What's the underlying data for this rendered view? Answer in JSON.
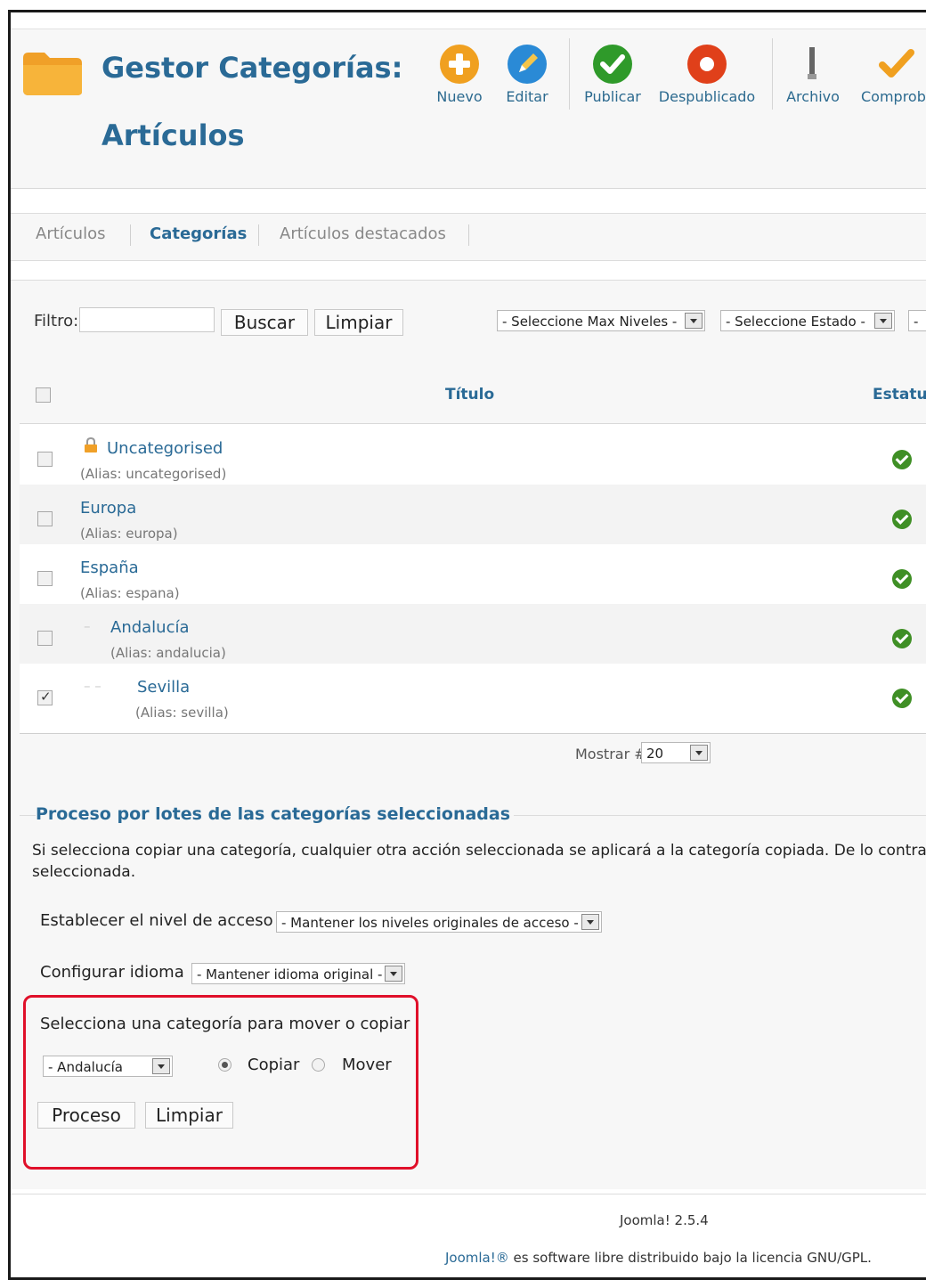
{
  "header": {
    "title_line1": "Gestor Categorías:",
    "title_line2": "Artículos"
  },
  "toolbar": [
    {
      "label": "Nuevo",
      "icon": "add-icon",
      "color": "#f0a020"
    },
    {
      "label": "Editar",
      "icon": "edit-icon",
      "color": "#2a8ad6"
    },
    {
      "label": "Publicar",
      "icon": "publish-icon",
      "color": "#2f9a2a"
    },
    {
      "label": "Despublicado",
      "icon": "unpublish-icon",
      "color": "#e0401a"
    },
    {
      "label": "Archivo",
      "icon": "archive-icon",
      "color": "#777777"
    },
    {
      "label": "Comproba",
      "icon": "checkin-icon",
      "color": "#f0a020"
    }
  ],
  "tabs": [
    {
      "label": "Artículos",
      "active": false
    },
    {
      "label": "Categorías",
      "active": true
    },
    {
      "label": "Artículos destacados",
      "active": false
    }
  ],
  "filter": {
    "label": "Filtro:",
    "value": "",
    "search_button": "Buscar",
    "clear_button": "Limpiar",
    "max_levels": "- Seleccione Max Niveles -",
    "status": "- Seleccione Estado -",
    "more": "-"
  },
  "table": {
    "col_title": "Título",
    "col_status": "Estatus",
    "rows": [
      {
        "name": "Uncategorised",
        "alias": "(Alias: uncategorised)",
        "checked": false,
        "status": "published",
        "locked": true,
        "level": 1
      },
      {
        "name": "Europa",
        "alias": "(Alias: europa)",
        "checked": false,
        "status": "published",
        "locked": false,
        "level": 1
      },
      {
        "name": "España",
        "alias": "(Alias: espana)",
        "checked": false,
        "status": "published",
        "locked": false,
        "level": 1
      },
      {
        "name": "Andalucía",
        "alias": "(Alias: andalucia)",
        "checked": false,
        "status": "published",
        "locked": false,
        "level": 2
      },
      {
        "name": "Sevilla",
        "alias": "(Alias: sevilla)",
        "checked": true,
        "status": "published",
        "locked": false,
        "level": 3
      }
    ]
  },
  "pagination": {
    "label": "Mostrar #",
    "value": "20"
  },
  "batch": {
    "legend": "Proceso por lotes de las categorías seleccionadas",
    "description": "Si selecciona copiar una categoría, cualquier otra acción seleccionada se aplicará a la categoría copiada. De lo contra seleccionada.",
    "access_label": "Establecer el nivel de acceso",
    "access_value": "- Mantener los niveles originales de acceso -",
    "language_label": "Configurar idioma",
    "language_value": "- Mantener idioma original -",
    "move_copy_label": "Selecciona una categoría para mover o copiar",
    "category_value": "- Andalucía",
    "copy_label": "Copiar",
    "move_label": "Mover",
    "copy_selected": true,
    "process_button": "Proceso",
    "clear_button": "Limpiar",
    "highlight_color": "#e0102a"
  },
  "footer": {
    "version": "Joomla! 2.5.4",
    "license_link": "Joomla!®",
    "license_text": " es software libre distribuido bajo la licencia GNU/GPL."
  }
}
